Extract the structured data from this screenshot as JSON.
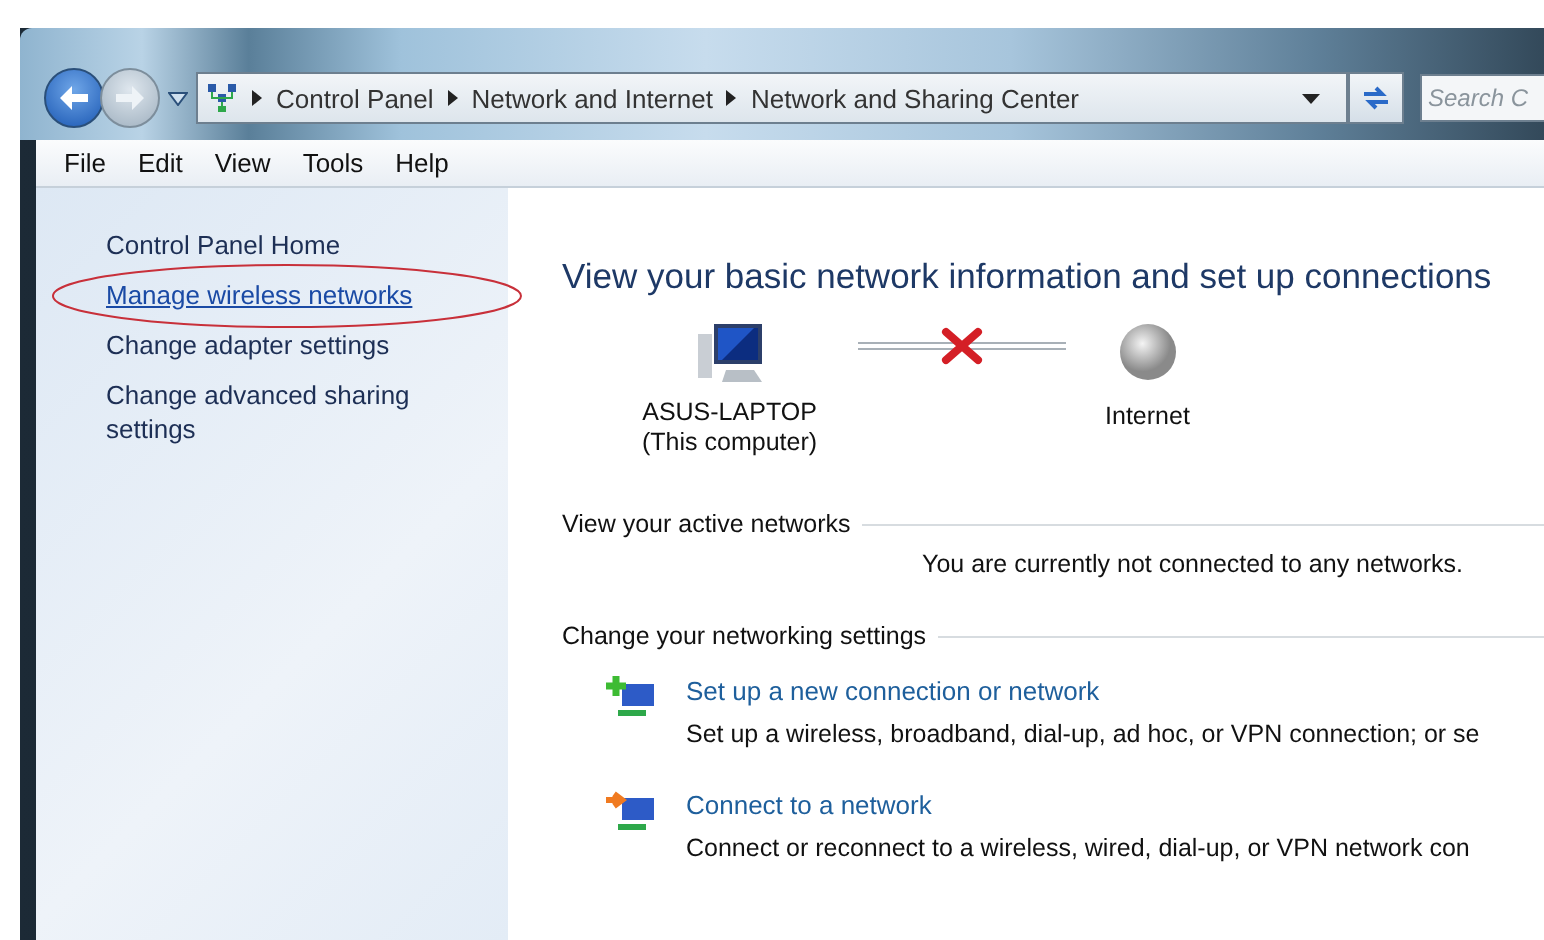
{
  "address_bar": {
    "crumbs": [
      "Control Panel",
      "Network and Internet",
      "Network and Sharing Center"
    ],
    "search": {
      "placeholder": "Search C"
    }
  },
  "menu": [
    "File",
    "Edit",
    "View",
    "Tools",
    "Help"
  ],
  "sidebar": {
    "items": [
      {
        "label": "Control Panel Home",
        "kind": "plain",
        "circled": false
      },
      {
        "label": "Manage wireless networks",
        "kind": "link",
        "circled": true
      },
      {
        "label": "Change adapter settings",
        "kind": "link",
        "circled": false
      },
      {
        "label": "Change advanced sharing settings",
        "kind": "link",
        "circled": false
      }
    ]
  },
  "content": {
    "title": "View your basic network information and set up connections",
    "map": {
      "computer": {
        "name": "ASUS-LAPTOP",
        "note": "(This computer)"
      },
      "connected": false,
      "internet": "Internet"
    },
    "active_networks": {
      "heading": "View your active networks",
      "message": "You are currently not connected to any networks."
    },
    "settings": {
      "heading": "Change your networking settings",
      "items": [
        {
          "kind": "new",
          "title": "Set up a new connection or network",
          "description": "Set up a wireless, broadband, dial-up, ad hoc, or VPN connection; or se"
        },
        {
          "kind": "connect",
          "title": "Connect to a network",
          "description": "Connect or reconnect to a wireless, wired, dial-up, or VPN network con"
        }
      ]
    }
  }
}
